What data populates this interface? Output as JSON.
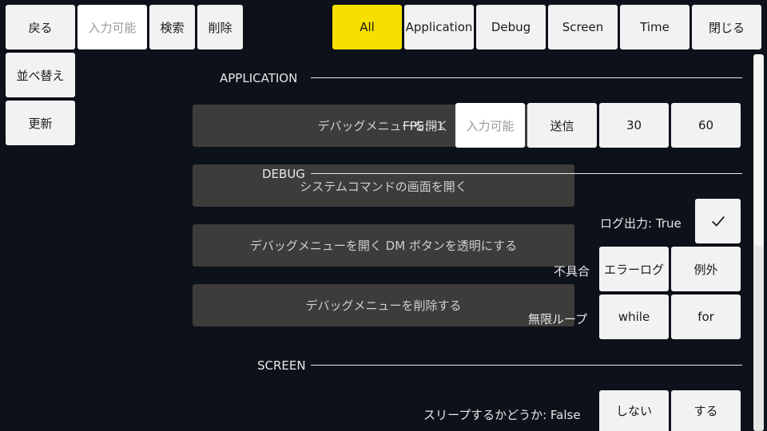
{
  "toolbar": {
    "back": "戻る",
    "search_input_placeholder": "入力可能",
    "search": "検索",
    "delete": "削除",
    "sort": "並べ替え",
    "refresh": "更新",
    "close": "閉じる"
  },
  "tabs": [
    {
      "label": "All",
      "active": true
    },
    {
      "label": "Application",
      "active": false
    },
    {
      "label": "Debug",
      "active": false
    },
    {
      "label": "Screen",
      "active": false
    },
    {
      "label": "Time",
      "active": false
    }
  ],
  "colors": {
    "background": "#0d1119",
    "active_tab": "#f5e000",
    "button": "#f2f2f2",
    "panel": "#3d3c3b"
  },
  "sections": {
    "application": "APPLICATION",
    "debug": "DEBUG",
    "screen": "SCREEN"
  },
  "panels": {
    "open_debug_menu": "デバッグメニューを開く",
    "open_system_command": "システムコマンドの画面を開く",
    "transparent_dm_button": "デバッグメニューを開く DM ボタンを透明にする",
    "delete_debug_menu": "デバッグメニューを削除する"
  },
  "fps": {
    "label": "FPS: -1",
    "input_placeholder": "入力可能",
    "send": "送信",
    "option_30": "30",
    "option_60": "60"
  },
  "debug": {
    "log_output_label": "ログ出力: True",
    "log_output_icon": "check-icon",
    "error_label": "不具合",
    "error_log": "エラーログ",
    "exception": "例外",
    "infinite_loop_label": "無限ループ",
    "while": "while",
    "for": "for"
  },
  "screen": {
    "sleep_label": "スリープするかどうか: False",
    "no": "しない",
    "yes": "する"
  }
}
